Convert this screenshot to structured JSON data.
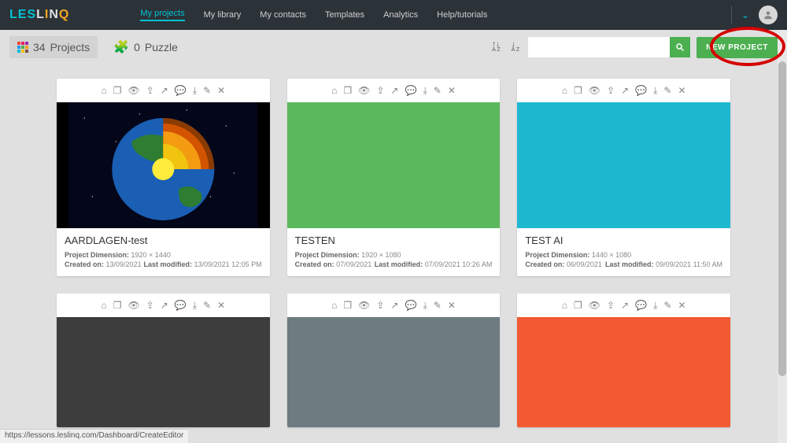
{
  "logo": {
    "part1": "LES",
    "part2": "L",
    "part3": "I",
    "part4": "N",
    "part5": "Q"
  },
  "nav": {
    "items": [
      "My projects",
      "My library",
      "My contacts",
      "Templates",
      "Analytics",
      "Help/tutorials"
    ],
    "active_index": 0
  },
  "toolbar": {
    "tabs": [
      {
        "count": "34",
        "label": "Projects"
      },
      {
        "count": "0",
        "label": "Puzzle"
      }
    ],
    "search_placeholder": "",
    "new_project_label": "NEW PROJECT"
  },
  "projects": [
    {
      "title": "AARDLAGEN-test",
      "dimension_label": "Project Dimension:",
      "dimension": "1920 × 1440",
      "created_label": "Created on:",
      "created": "13/09/2021",
      "modified_label": "Last modified:",
      "modified": "13/09/2021 12:05 PM",
      "thumb_type": "earth"
    },
    {
      "title": "TESTEN",
      "dimension_label": "Project Dimension:",
      "dimension": "1920 × 1080",
      "created_label": "Created on:",
      "created": "07/09/2021",
      "modified_label": "Last modified:",
      "modified": "07/09/2021 10:26 AM",
      "thumb_color": "#5cb85c"
    },
    {
      "title": "TEST AI",
      "dimension_label": "Project Dimension:",
      "dimension": "1440 × 1080",
      "created_label": "Created on:",
      "created": "06/09/2021",
      "modified_label": "Last modified:",
      "modified": "09/09/2021 11:50 AM",
      "thumb_color": "#1eb8d1"
    },
    {
      "title": "",
      "thumb_color": "#3d3d3d",
      "partial": true
    },
    {
      "title": "",
      "thumb_color": "#6e7b81",
      "partial": true
    },
    {
      "title": "",
      "thumb_color": "#f15a32",
      "partial": true
    }
  ],
  "statusbar": {
    "url": "https://lessons.leslinq.com/Dashboard/CreateEditor"
  },
  "icons": {
    "card_actions": [
      "home-icon",
      "copy-icon",
      "eye-icon",
      "share-icon",
      "export-icon",
      "comment-icon",
      "download-icon",
      "edit-icon",
      "close-icon"
    ]
  }
}
